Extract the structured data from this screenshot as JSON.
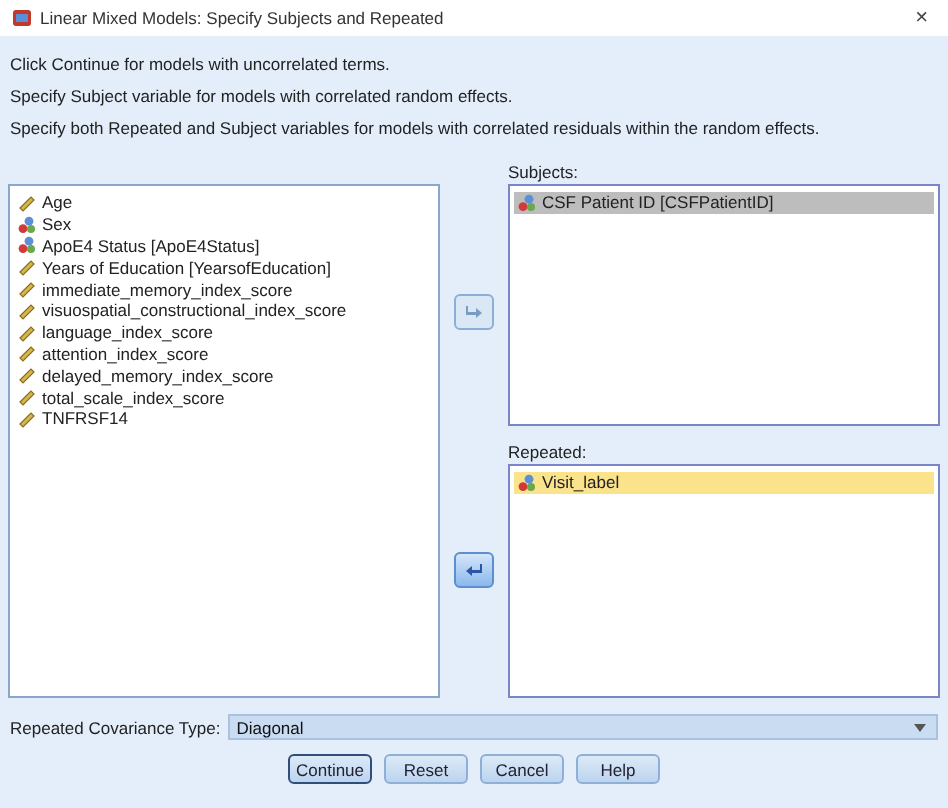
{
  "window": {
    "title": "Linear Mixed Models: Specify Subjects and Repeated",
    "close": "×"
  },
  "instructions": [
    "Click Continue for models with uncorrelated terms.",
    "Specify Subject variable for models with correlated random effects.",
    "Specify both Repeated and Subject variables for models with correlated residuals within the random effects."
  ],
  "variables": [
    {
      "name": "Age",
      "kind": "scale",
      "selected": false
    },
    {
      "name": "Sex",
      "kind": "nominal",
      "selected": false
    },
    {
      "name": "ApoE4 Status [ApoE4Status]",
      "kind": "nominal",
      "selected": false
    },
    {
      "name": "Years of Education [YearsofEducation]",
      "kind": "scale",
      "selected": false
    },
    {
      "name": "immediate_memory_index_score",
      "kind": "scale",
      "selected": false
    },
    {
      "name": "visuospatial_constructional_index_score",
      "kind": "scale",
      "selected": false
    },
    {
      "name": "language_index_score",
      "kind": "scale",
      "selected": false
    },
    {
      "name": "attention_index_score",
      "kind": "scale",
      "selected": false
    },
    {
      "name": "delayed_memory_index_score",
      "kind": "scale",
      "selected": false
    },
    {
      "name": "total_scale_index_score",
      "kind": "scale",
      "selected": false
    },
    {
      "name": "TNFRSF14",
      "kind": "scale",
      "selected": false
    }
  ],
  "subjects": {
    "label": "Subjects:",
    "focused": false,
    "move_disabled": true,
    "items": [
      {
        "name": "CSF Patient ID [CSFPatientID]",
        "kind": "nominal",
        "selected": true
      }
    ]
  },
  "repeated": {
    "label": "Repeated:",
    "focused": true,
    "move_disabled": false,
    "items": [
      {
        "name": "Visit_label",
        "kind": "nominal",
        "selected": true
      }
    ]
  },
  "covariance": {
    "label": "Repeated Covariance Type:",
    "value": "Diagonal"
  },
  "buttons": [
    {
      "label": "Continue",
      "default": true
    },
    {
      "label": "Reset",
      "default": false
    },
    {
      "label": "Cancel",
      "default": false
    },
    {
      "label": "Help",
      "default": false
    }
  ]
}
